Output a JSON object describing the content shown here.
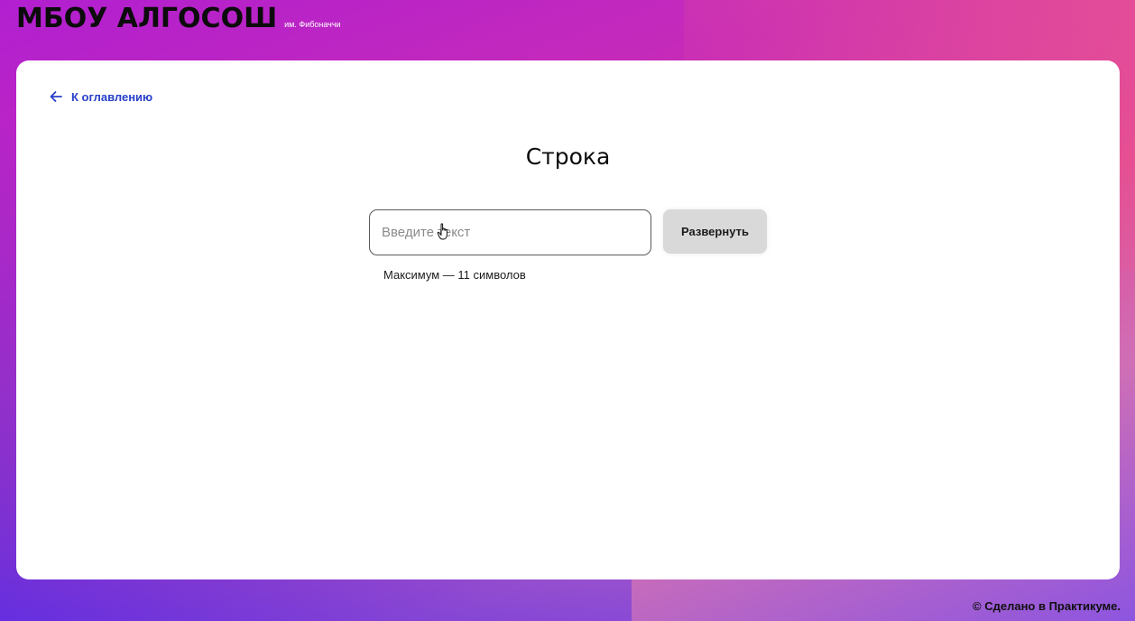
{
  "header": {
    "logo": "МБОУ АЛГОСОШ",
    "logo_sub": "им. Фибоначчи"
  },
  "nav": {
    "back_label": "К оглавлению",
    "back_icon": "arrow-left-icon"
  },
  "main": {
    "title": "Строка",
    "input": {
      "value": "",
      "placeholder": "Введите текст"
    },
    "submit_label": "Развернуть",
    "hint": "Максимум — 11 символов"
  },
  "footer": {
    "text": "© Сделано в Практикуме."
  },
  "colors": {
    "accent": "#2840c8",
    "button_bg": "#d9d9d9",
    "gradient_start": "#b11fd0",
    "gradient_end": "#5530e8"
  }
}
